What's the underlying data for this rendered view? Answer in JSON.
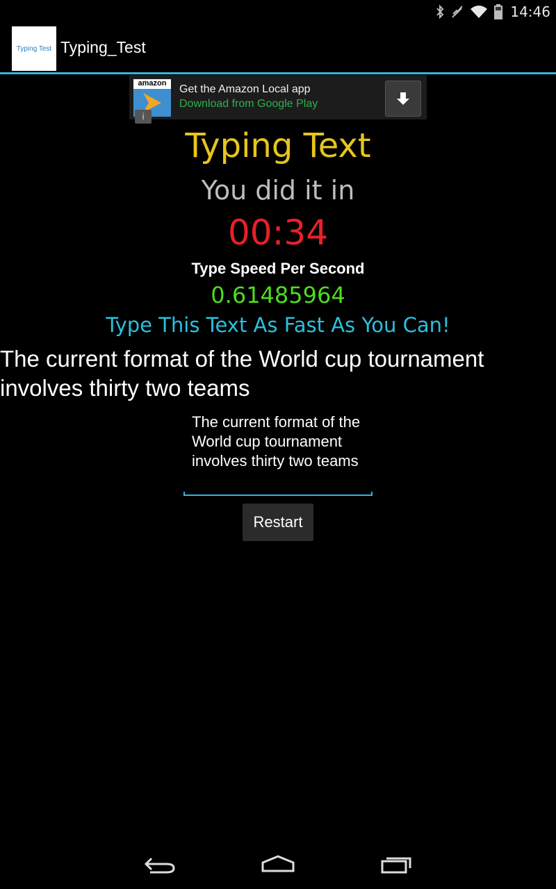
{
  "status_bar": {
    "time": "14:46",
    "icons": [
      "bluetooth-icon",
      "vibrate-icon",
      "wifi-icon",
      "battery-icon"
    ]
  },
  "action_bar": {
    "app_icon_label": "Typing Test",
    "title": "Typing_Test"
  },
  "ad": {
    "logo_text": "amazon",
    "title": "Get the Amazon Local app",
    "subtitle": "Download from Google Play",
    "info_glyph": "i"
  },
  "main": {
    "heading": "Typing Text",
    "result_label": "You did it in",
    "timer": "00:34",
    "speed_label": "Type Speed Per Second",
    "speed_value": "0.61485964",
    "instruction": "Type This Text As Fast As You Can!",
    "target_text": "The current format of the World cup tournament involves thirty two teams",
    "input_value": "The current format of the World cup tournament involves thirty two teams",
    "restart_label": "Restart"
  },
  "colors": {
    "accent": "#33b5e5",
    "heading": "#e6c61c",
    "timer": "#e8202a",
    "speed": "#4ddc1e",
    "instruction": "#2ac0de"
  }
}
